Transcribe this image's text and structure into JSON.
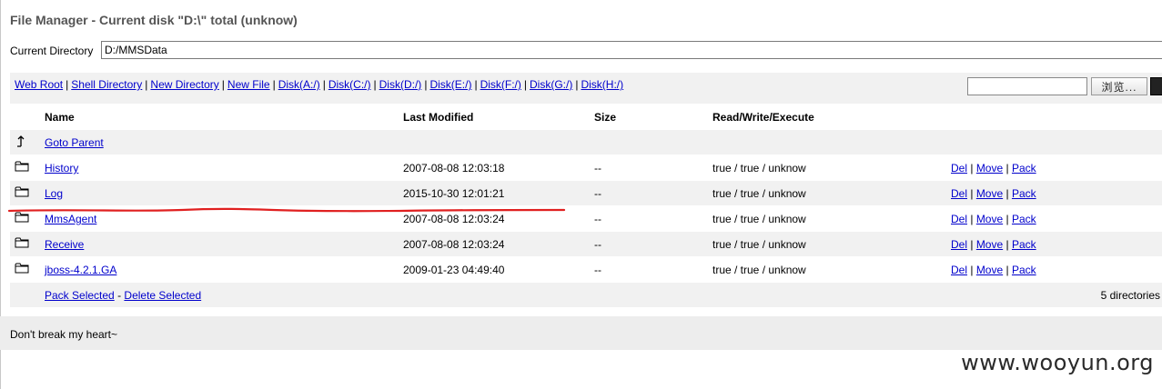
{
  "title": "File Manager - Current disk \"D:\\\" total (unknow)",
  "current_directory": {
    "label": "Current Directory",
    "value": "D:/MMSData"
  },
  "nav_links": [
    "Web Root",
    "Shell Directory",
    "New Directory",
    "New File",
    "Disk(A:/)",
    "Disk(C:/)",
    "Disk(D:/)",
    "Disk(E:/)",
    "Disk(F:/)",
    "Disk(G:/)",
    "Disk(H:/)"
  ],
  "upload": {
    "browse_label": "浏览..."
  },
  "table": {
    "headers": {
      "name": "Name",
      "modified": "Last Modified",
      "size": "Size",
      "rwx": "Read/Write/Execute"
    },
    "parent_label": "Goto Parent",
    "rows": [
      {
        "name": "History",
        "modified": "2007-08-08 12:03:18",
        "size": "--",
        "rwx": "true / true / unknow"
      },
      {
        "name": "Log",
        "modified": "2015-10-30 12:01:21",
        "size": "--",
        "rwx": "true / true / unknow"
      },
      {
        "name": "MmsAgent",
        "modified": "2007-08-08 12:03:24",
        "size": "--",
        "rwx": "true / true / unknow"
      },
      {
        "name": "Receive",
        "modified": "2007-08-08 12:03:24",
        "size": "--",
        "rwx": "true / true / unknow"
      },
      {
        "name": "jboss-4.2.1.GA",
        "modified": "2009-01-23 04:49:40",
        "size": "--",
        "rwx": "true / true / unknow"
      }
    ],
    "actions": {
      "del": "Del",
      "move": "Move",
      "pack": "Pack"
    },
    "footer": {
      "pack_selected": "Pack Selected",
      "separator": "-",
      "delete_selected": "Delete Selected",
      "count": "5 directories"
    }
  },
  "footer_text": "Don't break my heart~",
  "watermark": "www.wooyun.org",
  "icons": {
    "parent": "up-arrow-icon",
    "folder": "folder-icon"
  },
  "colors": {
    "link": "#0000cc",
    "row_alt": "#f1f1f1",
    "annotation": "#e02020"
  }
}
